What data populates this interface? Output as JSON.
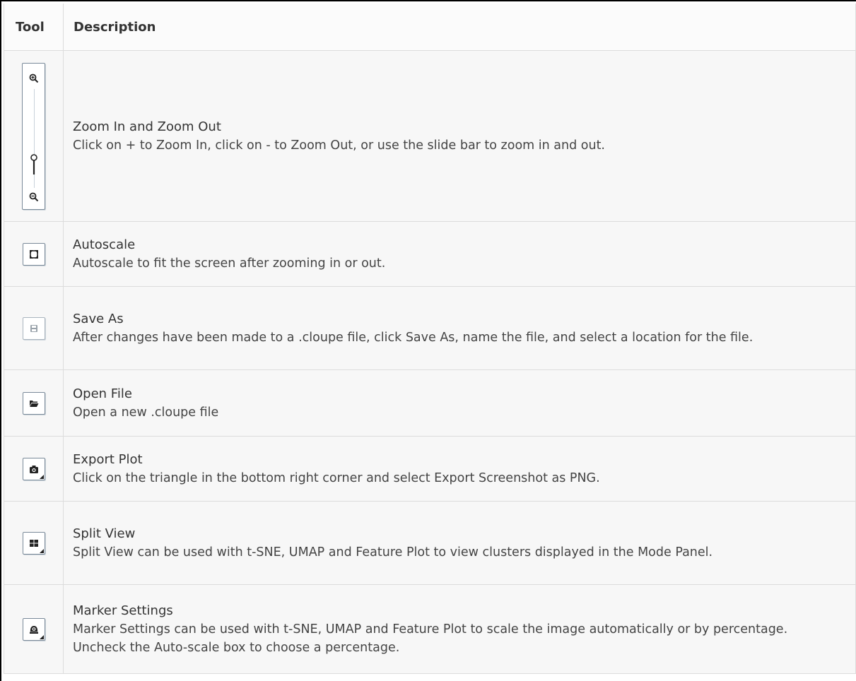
{
  "header": {
    "tool": "Tool",
    "description": "Description"
  },
  "rows": [
    {
      "icon": "zoom-slider-icon",
      "title": "Zoom In and Zoom Out",
      "description": "Click on + to Zoom In, click on - to Zoom Out, or use the slide bar to zoom in and out."
    },
    {
      "icon": "autoscale-icon",
      "title": "Autoscale",
      "description": "Autoscale to fit the screen after zooming in or out."
    },
    {
      "icon": "save-icon",
      "title": "Save As",
      "description": "After changes have been made to a .cloupe file, click Save As, name the file, and select a location for the file."
    },
    {
      "icon": "folder-open-icon",
      "title": "Open File",
      "description": "Open a new .cloupe file"
    },
    {
      "icon": "camera-icon",
      "title": "Export Plot",
      "description": "Click on the triangle in the bottom right corner and select Export Screenshot as PNG."
    },
    {
      "icon": "grid-icon",
      "title": "Split View",
      "description": "Split View can be used with t-SNE, UMAP and Feature Plot to view clusters displayed in the Mode Panel."
    },
    {
      "icon": "marker-settings-icon",
      "title": "Marker Settings",
      "description": "Marker Settings can be used with t-SNE, UMAP and Feature Plot to scale the image automatically or by percentage. Uncheck the Auto-scale box to choose a percentage."
    }
  ],
  "colors": {
    "border": "#dcdcdc",
    "row_bg": "#f7f7f7",
    "icon": "#222222"
  }
}
